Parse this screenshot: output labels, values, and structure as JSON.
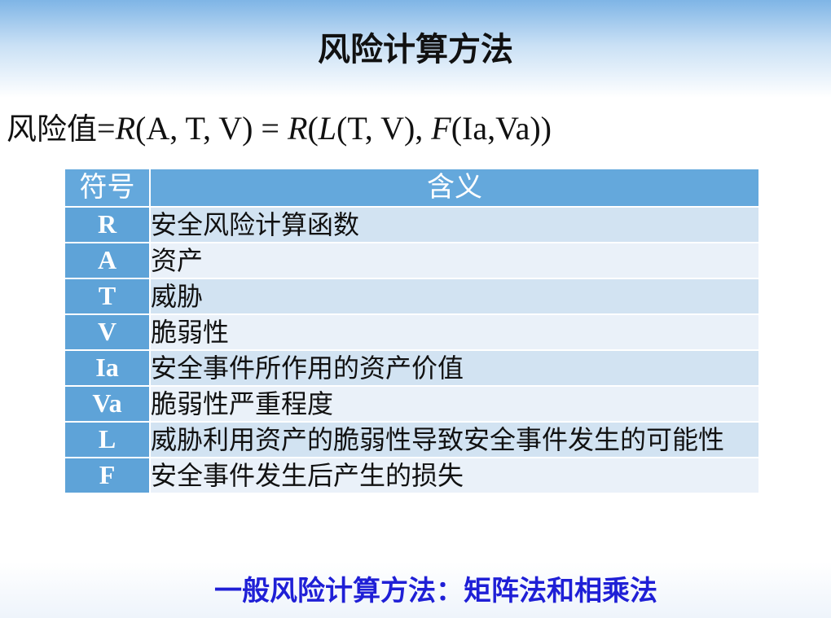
{
  "slide": {
    "title": "风险计算方法",
    "formula": {
      "prefix": "风险值",
      "eq1": "=",
      "R1": "R",
      "args1": "(A, T, V) = ",
      "R2": "R",
      "open": "(",
      "L": "L",
      "argsL": "(T, V), ",
      "F": "F",
      "argsF": "(Ia,Va))"
    },
    "table": {
      "headers": [
        "符号",
        "含义"
      ],
      "rows": [
        {
          "symbol": "R",
          "meaning": "安全风险计算函数"
        },
        {
          "symbol": "A",
          "meaning": "资产"
        },
        {
          "symbol": "T",
          "meaning": "威胁"
        },
        {
          "symbol": "V",
          "meaning": "脆弱性"
        },
        {
          "symbol": "Ia",
          "meaning": "安全事件所作用的资产价值"
        },
        {
          "symbol": "Va",
          "meaning": "脆弱性严重程度"
        },
        {
          "symbol": "L",
          "meaning": "威胁利用资产的脆弱性导致安全事件发生的可能性"
        },
        {
          "symbol": "F",
          "meaning": "安全事件发生后产生的损失"
        }
      ]
    },
    "footer": "一般风险计算方法：矩阵法和相乘法"
  },
  "colors": {
    "header_bg": "#64a8dc",
    "symbol_bg": "#5ea3d8",
    "row_dark": "#d2e3f2",
    "row_light": "#eaf1f9",
    "footer_text": "#1f1fd6"
  }
}
